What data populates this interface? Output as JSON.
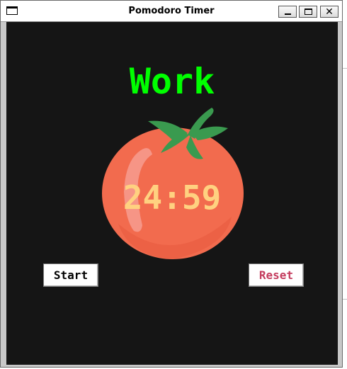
{
  "window": {
    "title": "Pomodoro Timer"
  },
  "timer": {
    "mode": "Work",
    "remaining": "24:59"
  },
  "buttons": {
    "start_label": "Start",
    "reset_label": "Reset"
  },
  "colors": {
    "background": "#151515",
    "mode_text": "#00ff00",
    "timer_text": "#ffd180",
    "tomato_body": "#f26b4e",
    "leaf": "#3a9a4f",
    "reset_text": "#c43c5e"
  },
  "icons": {
    "app": "window-icon",
    "minimize": "minimize-icon",
    "maximize": "maximize-icon",
    "close": "close-icon",
    "tomato": "tomato-icon"
  }
}
